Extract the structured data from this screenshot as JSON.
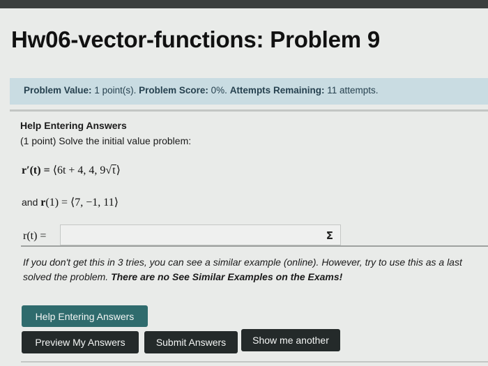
{
  "header": {
    "title": "Hw06-vector-functions: Problem 9"
  },
  "info_bar": {
    "value_label": "Problem Value:",
    "value": "1 point(s).",
    "score_label": "Problem Score:",
    "score": "0%.",
    "attempts_label": "Attempts Remaining:",
    "attempts": "11 attempts."
  },
  "problem": {
    "help_link": "Help Entering Answers",
    "statement": "(1 point) Solve the initial value problem:",
    "eq1_lhs": "r′(t) = ",
    "eq1_rhs_start": "⟨6t + 4, 4, 9",
    "eq1_radical": "√",
    "eq1_radicand": "t",
    "eq1_close": "⟩",
    "eq2_prefix": "and ",
    "eq2_r": "r",
    "eq2_rest": "(1) = ⟨7, −1, 11⟩",
    "answer_label": "r(t) =",
    "answer_value": "",
    "equation_editor_icon": "Σ"
  },
  "note": {
    "line1": "If you don't get this in 3 tries, you can see a similar example (online). However, try to use this as a last",
    "line2_start": "solved the problem. ",
    "line2_bold": "There are no See Similar Examples on the Exams!"
  },
  "buttons": {
    "help": "Help Entering Answers",
    "preview": "Preview My Answers",
    "submit": "Submit Answers",
    "show_another": "Show me another"
  },
  "colors": {
    "info_bar_bg": "#c9dce2",
    "help_button": "#2f6b6d",
    "dark_button": "#242a2a"
  }
}
